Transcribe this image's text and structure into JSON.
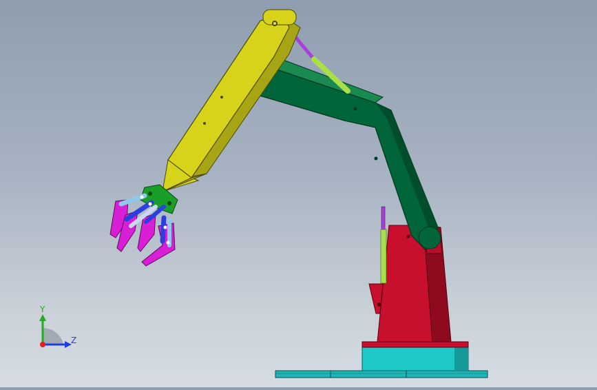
{
  "view": {
    "background_top": "#8f9db0",
    "background_bottom": "#d6dce3"
  },
  "model": {
    "colors": {
      "base_plate": "#1fb5b5",
      "turntable": "#1ec8c6",
      "base_body": "#c8102e",
      "lower_arm": "#00663a",
      "upper_arm": "#d7d21a",
      "cylinder_rod": "#a740d6",
      "cylinder_body": "#a8e04a",
      "gripper_jaw": "#d81fd6",
      "gripper_link": "#2b3fe0",
      "gripper_hub": "#1a9e2a"
    }
  },
  "triad": {
    "y_label": "Y",
    "z_label": "Z",
    "y_color": "#1fae1f",
    "z_color": "#1f3fe0",
    "x_color": "#e01f1f"
  }
}
